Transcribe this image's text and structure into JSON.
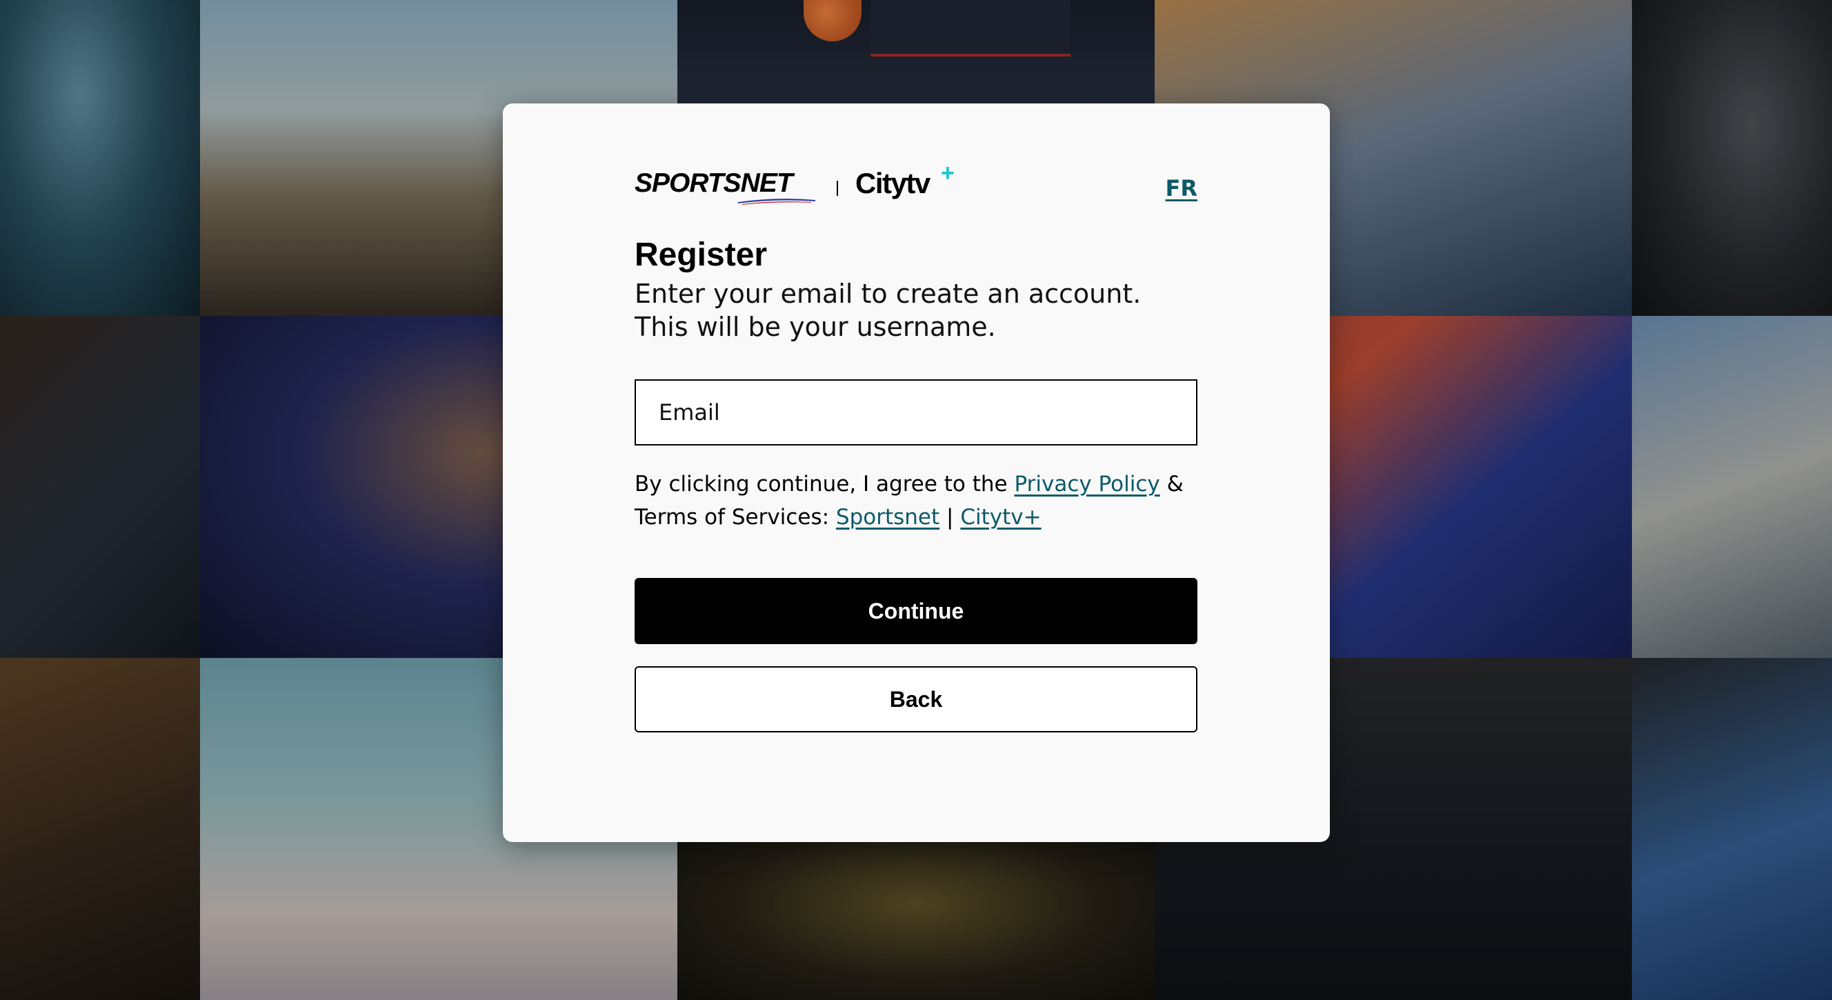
{
  "brand": {
    "sportsnet_logo_text": "SPORTSNET",
    "citytv_logo_text": "Citytv",
    "citytv_plus_symbol": "+",
    "accent_color": "#1fc3d2",
    "sportsnet_swoosh_colors": [
      "#2b3fa0",
      "#d12b2b"
    ]
  },
  "header": {
    "language_toggle": "FR"
  },
  "register": {
    "title": "Register",
    "subtitle": "Enter your email to create an account. This will be your username.",
    "email_placeholder": "Email",
    "email_value": ""
  },
  "terms": {
    "prefix": "By clicking continue, I agree to the ",
    "privacy_link": "Privacy Policy",
    "ampersand": " & ",
    "tos_prefix": "Terms of Services: ",
    "sportsnet_link": "Sportsnet",
    "separator": " | ",
    "citytv_link": "Citytv+"
  },
  "actions": {
    "continue_label": "Continue",
    "back_label": "Back"
  },
  "colors": {
    "link": "#0c5a68",
    "primary_button": "#000000",
    "modal_background": "#f9f9f9"
  }
}
